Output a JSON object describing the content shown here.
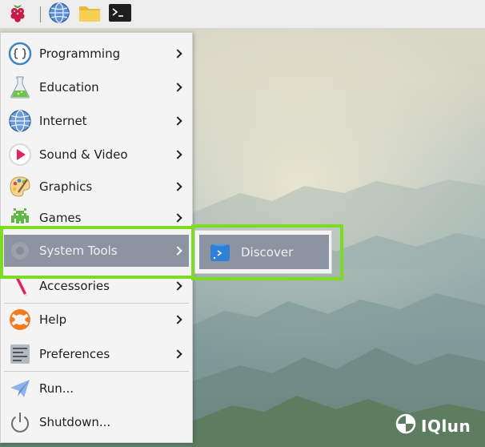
{
  "taskbar": {
    "icons": [
      "raspberry-menu-icon",
      "web-browser-icon",
      "file-manager-icon",
      "terminal-icon"
    ]
  },
  "menu": {
    "items": [
      {
        "label": "Programming",
        "icon": "programming-icon",
        "has_submenu": true
      },
      {
        "label": "Education",
        "icon": "education-icon",
        "has_submenu": true
      },
      {
        "label": "Internet",
        "icon": "internet-icon",
        "has_submenu": true
      },
      {
        "label": "Sound & Video",
        "icon": "sound-video-icon",
        "has_submenu": true
      },
      {
        "label": "Graphics",
        "icon": "graphics-icon",
        "has_submenu": true
      },
      {
        "label": "Games",
        "icon": "games-icon",
        "has_submenu": true
      },
      {
        "label": "System Tools",
        "icon": "system-tools-icon",
        "has_submenu": true,
        "active": true
      },
      {
        "label": "Accessories",
        "icon": "accessories-icon",
        "has_submenu": true
      },
      {
        "label": "Help",
        "icon": "help-icon",
        "has_submenu": true
      },
      {
        "label": "Preferences",
        "icon": "preferences-icon",
        "has_submenu": true
      },
      {
        "label": "Run...",
        "icon": "run-icon",
        "has_submenu": false
      },
      {
        "label": "Shutdown...",
        "icon": "shutdown-icon",
        "has_submenu": false
      }
    ]
  },
  "submenu": {
    "items": [
      {
        "label": "Discover",
        "icon": "discover-icon",
        "active": true
      }
    ]
  },
  "watermark": {
    "text": "IQlun"
  },
  "colors": {
    "highlight_box": "#7ddc21",
    "active_item_bg": "#8c94a1",
    "menu_bg": "#f4f4f4",
    "taskbar_bg": "#ededed"
  }
}
